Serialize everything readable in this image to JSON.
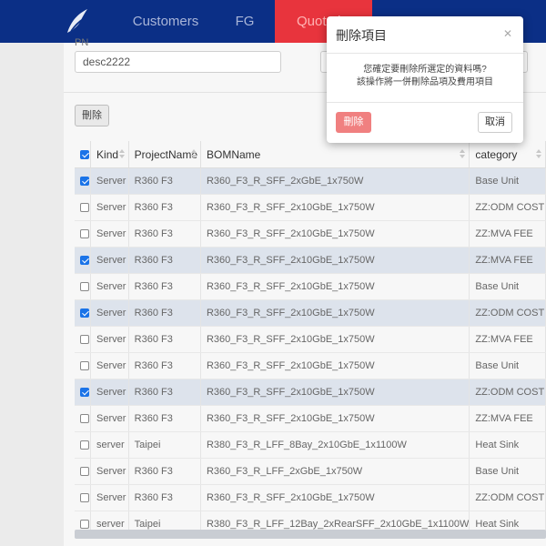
{
  "nav": {
    "items": [
      {
        "label": "Customers"
      },
      {
        "label": "FG"
      },
      {
        "label": "Quotation"
      }
    ]
  },
  "filter": {
    "label": "PN",
    "input_value": "desc2222"
  },
  "toolbar": {
    "delete_label": "刪除"
  },
  "table": {
    "headers": [
      "Kind",
      "ProjectName",
      "BOMName",
      "category"
    ],
    "rows": [
      {
        "checked": true,
        "kind": "Server",
        "project": "R360 F3",
        "bom": "R360_F3_R_SFF_2xGbE_1x750W",
        "category": "Base Unit"
      },
      {
        "checked": false,
        "kind": "Server",
        "project": "R360 F3",
        "bom": "R360_F3_R_SFF_2x10GbE_1x750W",
        "category": "ZZ:ODM COST"
      },
      {
        "checked": false,
        "kind": "Server",
        "project": "R360 F3",
        "bom": "R360_F3_R_SFF_2x10GbE_1x750W",
        "category": "ZZ:MVA FEE"
      },
      {
        "checked": true,
        "kind": "Server",
        "project": "R360 F3",
        "bom": "R360_F3_R_SFF_2x10GbE_1x750W",
        "category": "ZZ:MVA FEE"
      },
      {
        "checked": false,
        "kind": "Server",
        "project": "R360 F3",
        "bom": "R360_F3_R_SFF_2x10GbE_1x750W",
        "category": "Base Unit"
      },
      {
        "checked": true,
        "kind": "Server",
        "project": "R360 F3",
        "bom": "R360_F3_R_SFF_2x10GbE_1x750W",
        "category": "ZZ:ODM COST"
      },
      {
        "checked": false,
        "kind": "Server",
        "project": "R360 F3",
        "bom": "R360_F3_R_SFF_2x10GbE_1x750W",
        "category": "ZZ:MVA FEE"
      },
      {
        "checked": false,
        "kind": "Server",
        "project": "R360 F3",
        "bom": "R360_F3_R_SFF_2x10GbE_1x750W",
        "category": "Base Unit"
      },
      {
        "checked": true,
        "kind": "Server",
        "project": "R360 F3",
        "bom": "R360_F3_R_SFF_2x10GbE_1x750W",
        "category": "ZZ:ODM COST"
      },
      {
        "checked": false,
        "kind": "Server",
        "project": "R360 F3",
        "bom": "R360_F3_R_SFF_2x10GbE_1x750W",
        "category": "ZZ:MVA FEE"
      },
      {
        "checked": false,
        "kind": "server",
        "project": "Taipei",
        "bom": "R380_F3_R_LFF_8Bay_2x10GbE_1x1100W",
        "category": "Heat Sink"
      },
      {
        "checked": false,
        "kind": "Server",
        "project": "R360 F3",
        "bom": "R360_F3_R_LFF_2xGbE_1x750W",
        "category": "Base Unit"
      },
      {
        "checked": false,
        "kind": "Server",
        "project": "R360 F3",
        "bom": "R360_F3_R_SFF_2x10GbE_1x750W",
        "category": "ZZ:ODM COST"
      },
      {
        "checked": false,
        "kind": "server",
        "project": "Taipei",
        "bom": "R380_F3_R_LFF_12Bay_2xRearSFF_2x10GbE_1x1100W",
        "category": "Heat Sink"
      }
    ]
  },
  "modal": {
    "title": "刪除項目",
    "close_icon": "close-icon",
    "message_line1": "您確定要刪除所選定的資料嗎?",
    "message_line2": "該操作將一併刪除品項及費用項目",
    "confirm_label": "刪除",
    "cancel_label": "取消"
  },
  "colors": {
    "nav_bg": "#0b2f86",
    "nav_active": "#e8343d",
    "danger": "#f08080",
    "checkbox": "#1a73e8"
  }
}
